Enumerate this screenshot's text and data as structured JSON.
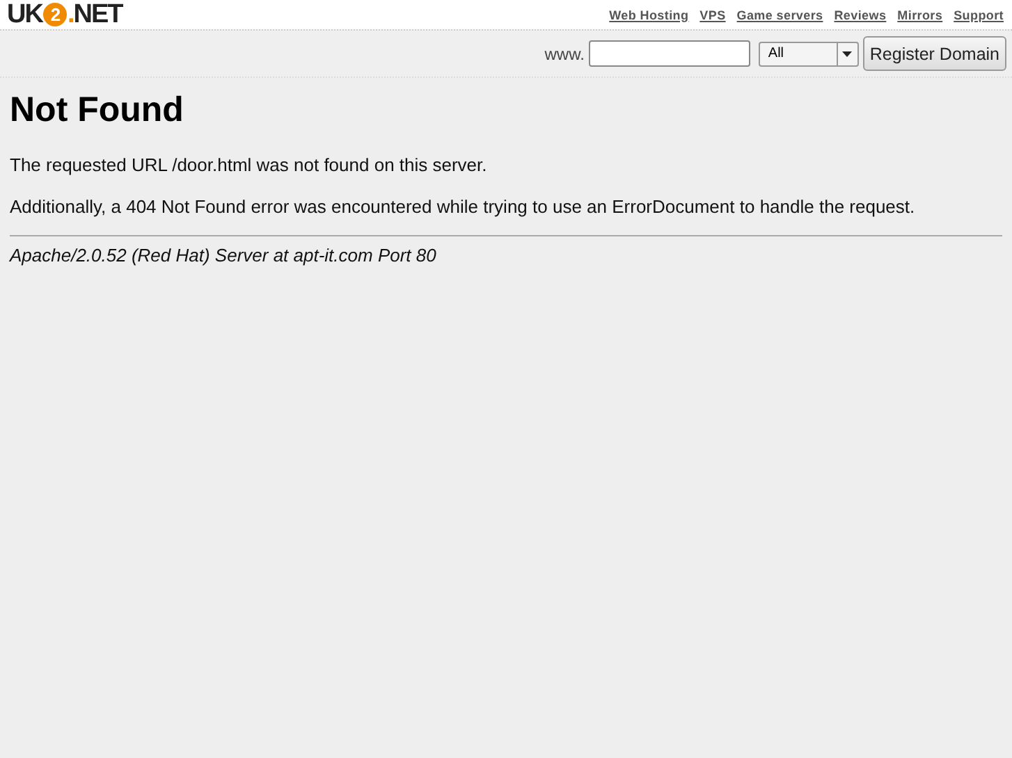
{
  "header": {
    "logo": [
      {
        "kind": "plain",
        "text": "UK"
      },
      {
        "kind": "badge",
        "text": "2"
      },
      {
        "kind": "accent",
        "text": "."
      },
      {
        "kind": "plain",
        "text": "NET"
      }
    ],
    "nav": [
      "Web Hosting",
      "VPS",
      "Game servers",
      "Reviews",
      "Mirrors",
      "Support"
    ]
  },
  "domain_bar": {
    "prefix": "www.",
    "tld": "All",
    "button": "Register Domain"
  },
  "page": {
    "title": "Not Found",
    "paragraphs": [
      "The requested URL /door.html was not found on this server.",
      "Additionally, a 404 Not Found error was encountered while trying to use an ErrorDocument to handle the request."
    ],
    "address": "Apache/2.0.52 (Red Hat) Server at apt-it.com Port 80"
  }
}
